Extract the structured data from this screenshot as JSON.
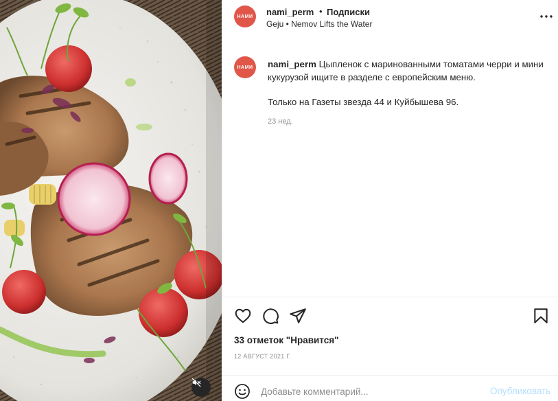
{
  "post": {
    "username": "nami_perm",
    "separator": "•",
    "follow_label": "Подписки",
    "music": "Geju • Nemov Lifts the Water",
    "avatar_text": "НАМИ"
  },
  "caption": {
    "username": "nami_perm",
    "line1": " Цыпленок с маринованными томатами черри и мини",
    "line2": "кукурузой ищите в разделе с европейским меню.",
    "line3": "Только на Газеты звезда 44 и Куйбышева 96.",
    "time": "23 нед."
  },
  "stats": {
    "likes": "33 отметок \"Нравится\"",
    "date": "12 АВГУСТ 2021 Г."
  },
  "comment": {
    "placeholder": "Добавьте комментарий...",
    "publish_label": "Опубликовать"
  },
  "icons": {
    "like": "heart-icon",
    "comment": "comment-icon",
    "share": "paper-plane-icon",
    "save": "bookmark-icon",
    "more": "more-horizontal-icon",
    "emoji": "emoji-icon",
    "mute": "speaker-muted-icon"
  },
  "colors": {
    "brand_avatar": "#e0574a",
    "publish_disabled": "#b2dffc",
    "muted_text": "#8e8e8e"
  }
}
